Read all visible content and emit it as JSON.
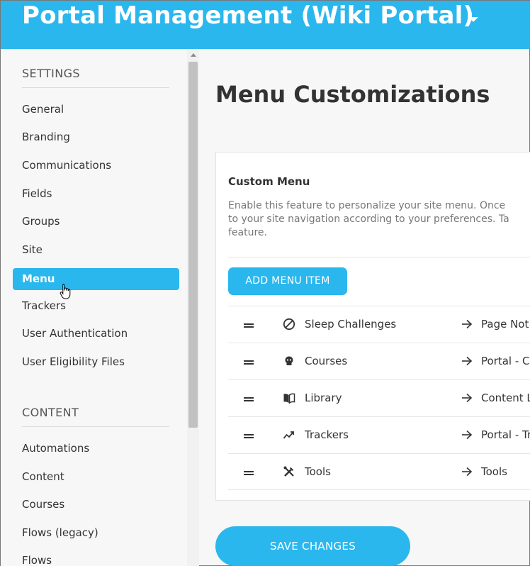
{
  "header": {
    "title": "Portal Management (Wiki Portal)"
  },
  "sidebar": {
    "settings_heading": "SETTINGS",
    "settings_items": [
      {
        "label": "General"
      },
      {
        "label": "Branding"
      },
      {
        "label": "Communications"
      },
      {
        "label": "Fields"
      },
      {
        "label": "Groups"
      },
      {
        "label": "Site"
      },
      {
        "label": "Menu",
        "active": true
      },
      {
        "label": "Trackers"
      },
      {
        "label": "User Authentication"
      },
      {
        "label": "User Eligibility Files"
      }
    ],
    "content_heading": "CONTENT",
    "content_items": [
      {
        "label": "Automations"
      },
      {
        "label": "Content"
      },
      {
        "label": "Courses"
      },
      {
        "label": "Flows (legacy)"
      },
      {
        "label": "Flows"
      }
    ]
  },
  "main": {
    "title": "Menu Customizations",
    "card": {
      "title": "Custom Menu",
      "description_lines": [
        "Enable this feature to personalize your site menu. Once",
        "to your site navigation according to your preferences. Ta",
        "feature."
      ],
      "add_button": "ADD MENU ITEM",
      "items": [
        {
          "icon": "ban-icon",
          "label": "Sleep Challenges",
          "target": "Page Not"
        },
        {
          "icon": "courses-icon",
          "label": "Courses",
          "target": "Portal - Co"
        },
        {
          "icon": "book-icon",
          "label": "Library",
          "target": "Content L"
        },
        {
          "icon": "trend-icon",
          "label": "Trackers",
          "target": "Portal - Tr"
        },
        {
          "icon": "tools-icon",
          "label": "Tools",
          "target": "Tools"
        }
      ]
    },
    "save_button": "SAVE CHANGES"
  },
  "colors": {
    "accent": "#2ab7ee"
  }
}
